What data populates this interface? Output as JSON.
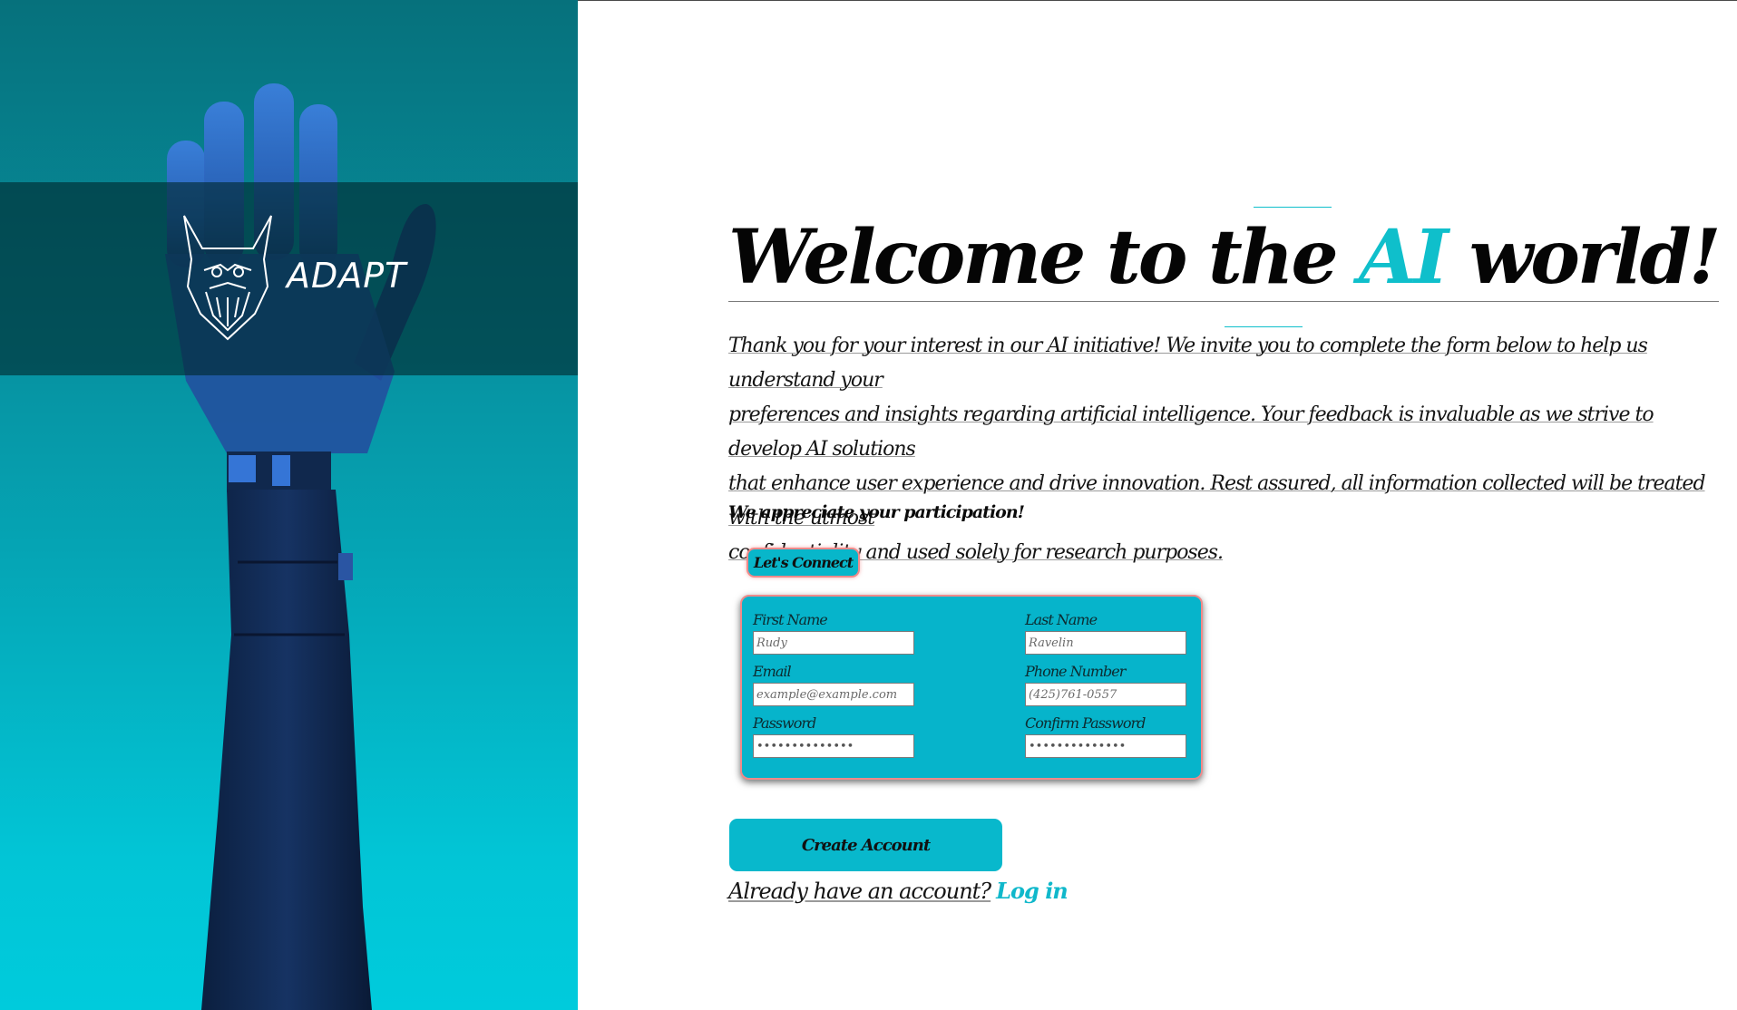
{
  "brand": {
    "name": "ADAPT",
    "logo_icon": "bearded-viking-mask-icon"
  },
  "hero": {
    "image": "robotic-hand-raised"
  },
  "headline": {
    "prefix": "Welcome to the ",
    "accent": "AI",
    "suffix": " world!"
  },
  "intro": {
    "lines": [
      "Thank you for your interest in our AI initiative! We invite you to complete the form below to help us understand your",
      "preferences and insights regarding artificial intelligence. Your feedback is invaluable as we strive to develop AI solutions",
      "that enhance user experience and drive innovation. Rest assured, all information collected will be treated with the utmost",
      "confidentiality and used solely for research purposes."
    ]
  },
  "appreciate": "We appreciate your participation!",
  "connect_button": "Let's Connect",
  "form": {
    "first_name": {
      "label": "First Name",
      "placeholder": "Rudy"
    },
    "last_name": {
      "label": "Last Name",
      "placeholder": "Ravelin"
    },
    "email": {
      "label": "Email",
      "placeholder": "example@example.com"
    },
    "phone": {
      "label": "Phone Number",
      "placeholder": "(425)761-0557"
    },
    "password": {
      "label": "Password",
      "value": "••••••••••••••"
    },
    "confirm_password": {
      "label": "Confirm Password",
      "value": "••••••••••••••"
    }
  },
  "create_button": "Create  Account",
  "login": {
    "prompt": "Already have an account?",
    "link": "Log in"
  },
  "colors": {
    "accent": "#0fbfcb",
    "button": "#08b8cc",
    "panel_top": "#06717c",
    "panel_bottom": "#00cbdc"
  }
}
